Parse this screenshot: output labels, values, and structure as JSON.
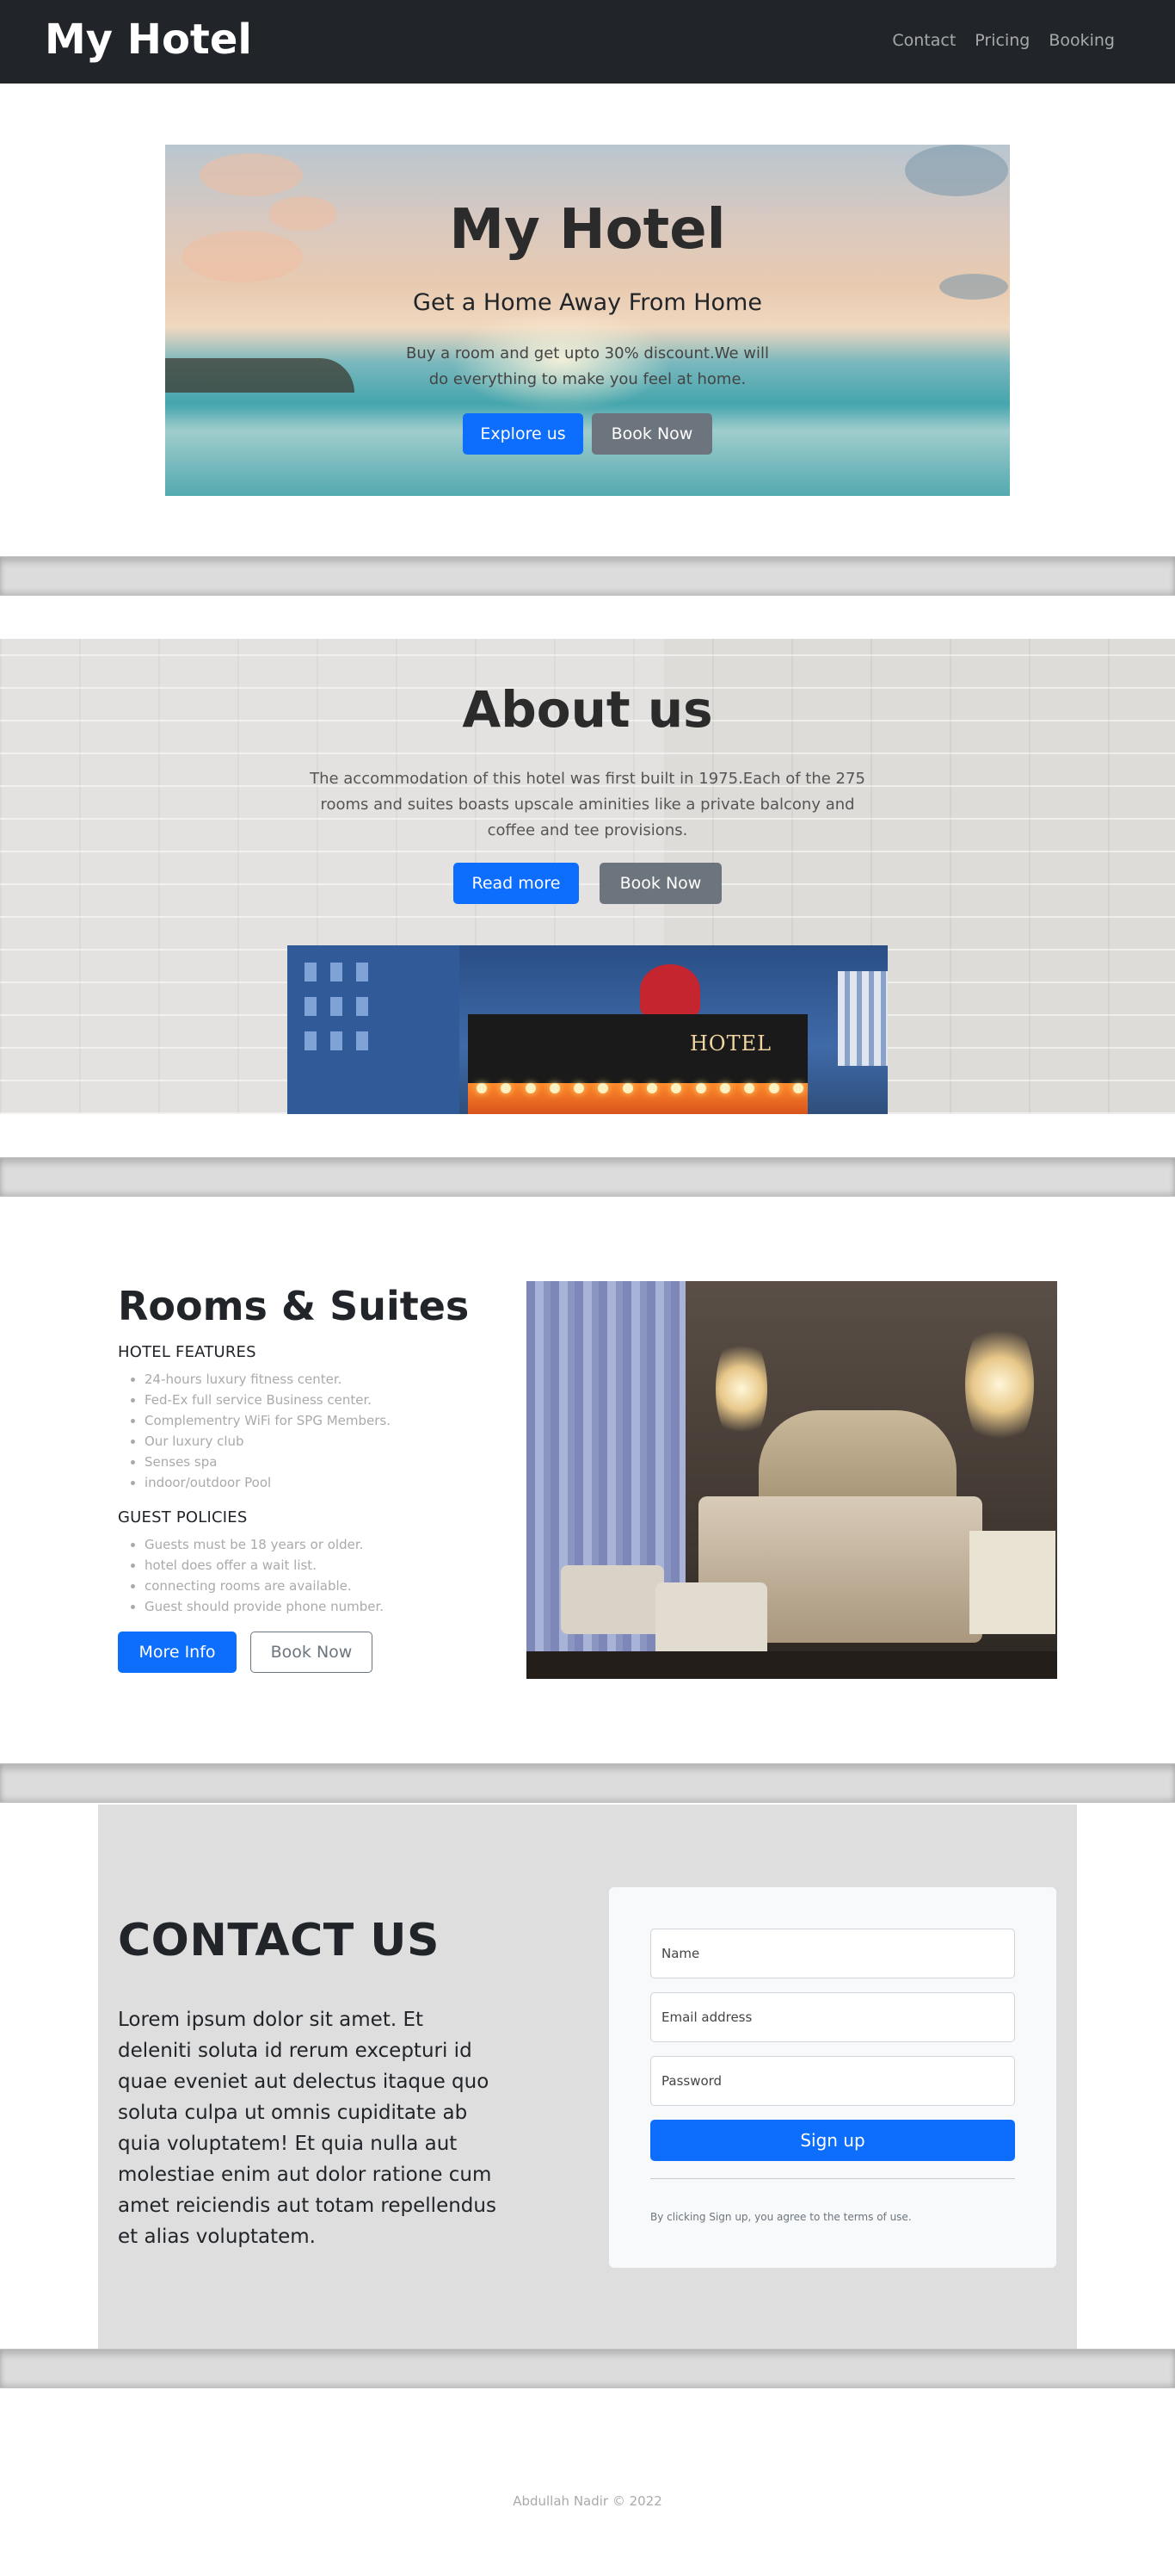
{
  "navbar": {
    "brand": "My Hotel",
    "links": [
      "Contact",
      "Pricing",
      "Booking"
    ]
  },
  "hero": {
    "title": "My Hotel",
    "subtitle": "Get a Home Away From Home",
    "text": "Buy a room and get upto 30% discount.We will do everything to make you feel at home.",
    "primary_btn": "Explore us",
    "secondary_btn": "Book Now"
  },
  "about": {
    "title": "About us",
    "text": "The accommodation of this hotel was first built in 1975.Each of the 275 rooms and suites boasts upscale aminities like a private balcony and coffee and tee provisions.",
    "primary_btn": "Read more",
    "secondary_btn": "Book Now",
    "photo_sign": "HOTEL"
  },
  "rooms": {
    "title": "Rooms & Suites",
    "features_heading": "HOTEL FEATURES",
    "features": [
      "24-hours luxury fitness center.",
      "Fed-Ex full service Business center.",
      "Complementry WiFi for SPG Members.",
      "Our luxury club",
      "Senses spa",
      "indoor/outdoor Pool"
    ],
    "policies_heading": "GUEST POLICIES",
    "policies": [
      "Guests must be 18 years or older.",
      "hotel does offer a wait list.",
      "connecting rooms are available.",
      "Guest should provide phone number."
    ],
    "primary_btn": "More Info",
    "secondary_btn": "Book Now"
  },
  "contact": {
    "title": "CONTACT US",
    "text": "Lorem ipsum dolor sit amet. Et deleniti soluta id rerum excepturi id quae eveniet aut delectus itaque quo soluta culpa ut omnis cupiditate ab quia voluptatem! Et quia nulla aut molestiae enim aut dolor ratione cum amet reiciendis aut totam repellendus et alias voluptatem.",
    "name_placeholder": "Name",
    "email_placeholder": "Email address",
    "password_placeholder": "Password",
    "signup_btn": "Sign up",
    "terms_note": "By clicking Sign up, you agree to the terms of use."
  },
  "footer": {
    "text": "Abdullah Nadir © 2022"
  },
  "colors": {
    "navbar": "#212529",
    "primary": "#0d6efd",
    "secondary": "#6c757d",
    "contact_bg": "#dedede"
  }
}
